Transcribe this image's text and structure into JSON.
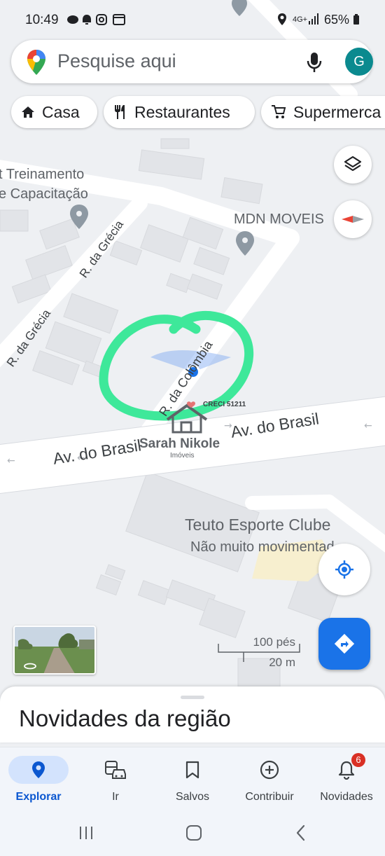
{
  "status_bar": {
    "time": "10:49",
    "network": "4G+",
    "battery": "65%"
  },
  "search": {
    "placeholder": "Pesquise aqui",
    "avatar_letter": "G"
  },
  "chips": [
    {
      "label": "Casa",
      "icon": "home-icon"
    },
    {
      "label": "Restaurantes",
      "icon": "restaurant-icon"
    },
    {
      "label": "Supermerca",
      "icon": "cart-icon"
    }
  ],
  "map": {
    "places": {
      "training_line1": "t Treinamento",
      "training_line2": "e Capacitação",
      "store": "MDN MOVEIS",
      "club": "Teuto Esporte Clube",
      "club_status": "Não muito movimentad"
    },
    "roads": {
      "grecia_1": "R. da Grécia",
      "grecia_2": "R. da Grécia",
      "colombia": "R. da Colômbia",
      "brasil_1": "Av. do Brasil",
      "brasil_2": "Av. do Brasil"
    },
    "scale": {
      "feet": "100 pés",
      "meters": "20 m"
    }
  },
  "watermark": {
    "creci": "CRECI 51211",
    "brand": "Sarah Nikole",
    "sub": "Imóveis"
  },
  "sheet": {
    "title": "Novidades da região"
  },
  "nav": {
    "items": [
      {
        "label": "Explorar",
        "icon": "explore-pin-icon",
        "active": true
      },
      {
        "label": "Ir",
        "icon": "commute-icon"
      },
      {
        "label": "Salvos",
        "icon": "bookmark-icon"
      },
      {
        "label": "Contribuir",
        "icon": "add-circle-icon"
      },
      {
        "label": "Novidades",
        "icon": "bell-icon",
        "badge": "6"
      }
    ]
  },
  "colors": {
    "accent": "#1a73e8",
    "highlight_circle": "#3ee89a",
    "avatar": "#0b8a8f",
    "badge": "#d93025"
  }
}
